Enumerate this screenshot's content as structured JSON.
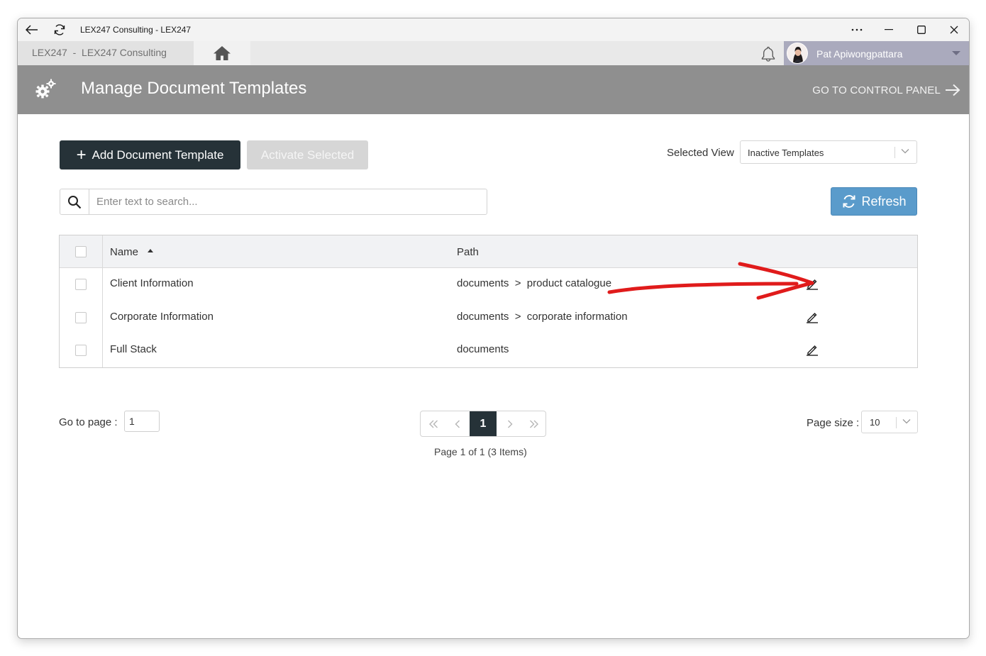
{
  "window": {
    "title": "LEX247 Consulting - LEX247"
  },
  "appbar": {
    "breadcrumb": "LEX247  -  LEX247 Consulting",
    "user_name": "Pat Apiwongpattara"
  },
  "header": {
    "title": "Manage Document Templates",
    "control_panel_link": "GO TO CONTROL PANEL"
  },
  "toolbar": {
    "add_label": "Add Document Template",
    "activate_label": "Activate Selected",
    "selected_view_label": "Selected View",
    "selected_view_value": "Inactive Templates",
    "refresh_label": "Refresh"
  },
  "search": {
    "placeholder": "Enter text to search..."
  },
  "table": {
    "columns": {
      "name": "Name",
      "path": "Path"
    },
    "rows": [
      {
        "name": "Client Information",
        "path": "documents  >  product catalogue"
      },
      {
        "name": "Corporate Information",
        "path": "documents  >  corporate information"
      },
      {
        "name": "Full Stack",
        "path": "documents"
      }
    ]
  },
  "pager": {
    "goto_label": "Go to page :",
    "goto_value": "1",
    "current_page": "1",
    "info": "Page 1 of 1 (3 Items)",
    "page_size_label": "Page size :",
    "page_size_value": "10"
  },
  "colors": {
    "header_bg": "#8f8f8f",
    "primary_dark": "#263238",
    "refresh_blue": "#5a9bcb",
    "annotation_red": "#e01b1b",
    "user_bar": "#aaaabd"
  }
}
